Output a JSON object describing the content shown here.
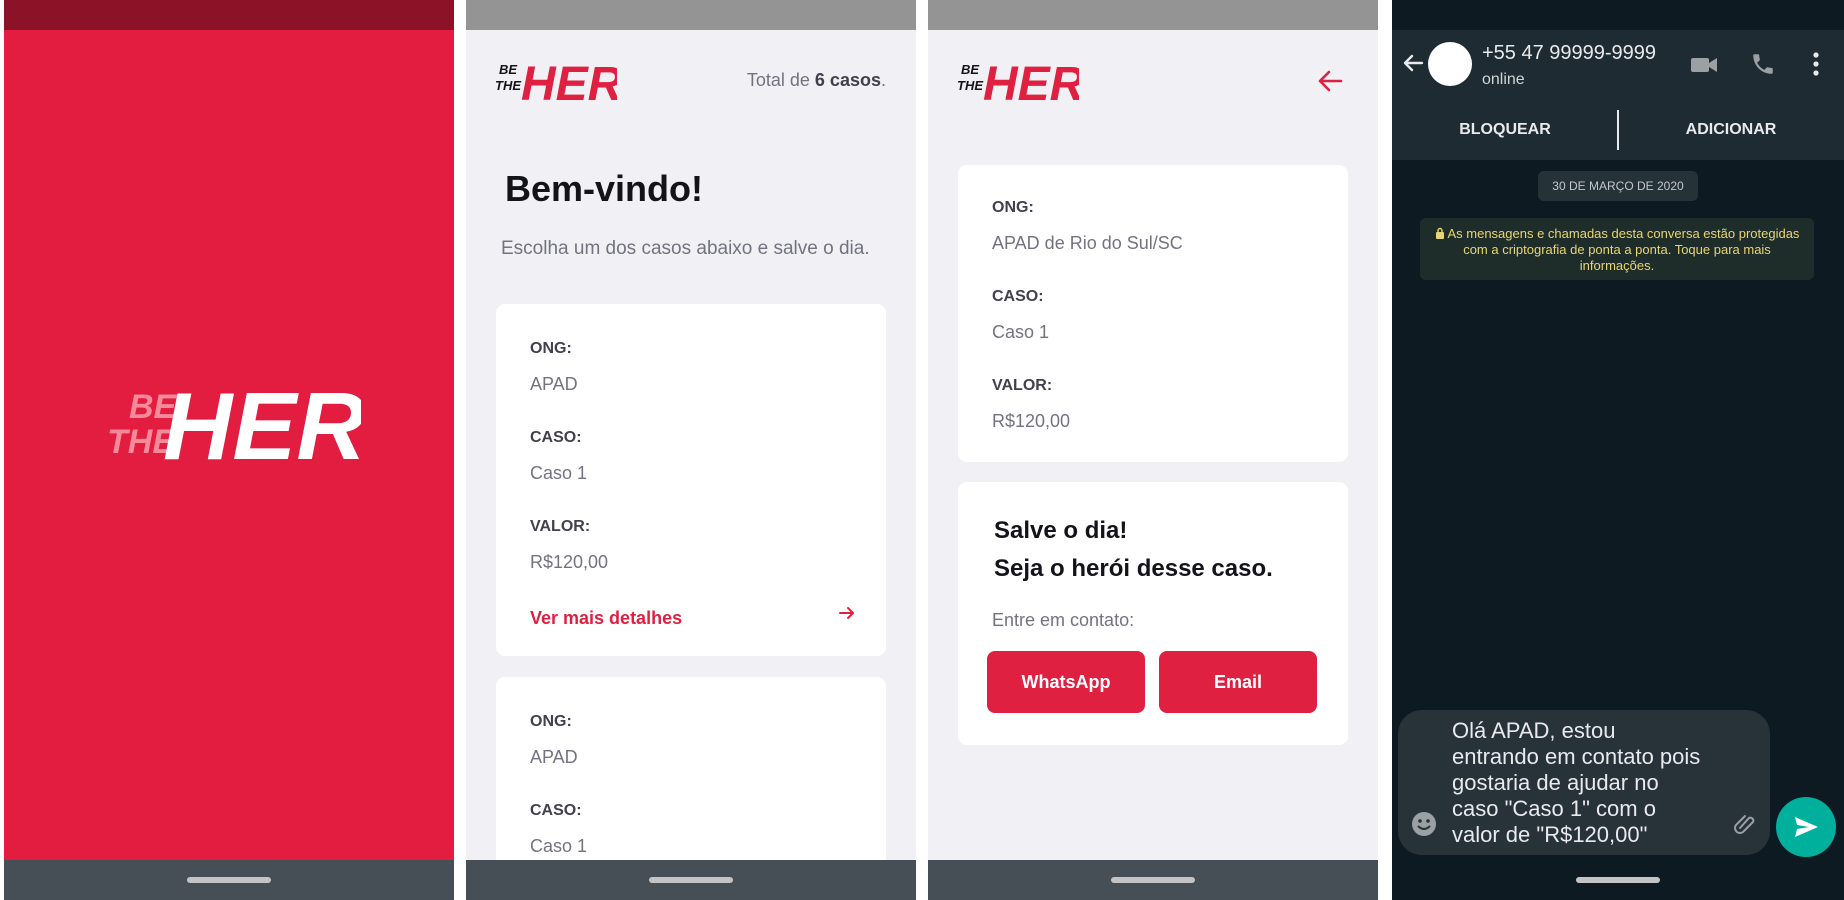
{
  "colors": {
    "brand_red": "#e02041",
    "splash_bg": "#e31d40",
    "app_bg": "#f0f0f5",
    "wa_bg": "#0e1a21",
    "wa_send": "#00af9c"
  },
  "logo": {
    "small": "BE THE",
    "big": "HERO"
  },
  "list_screen": {
    "total_prefix": "Total de ",
    "total_count": "6 casos",
    "total_suffix": ".",
    "title": "Bem-vindo!",
    "subtitle": "Escolha um dos casos abaixo e salve o dia.",
    "cards": [
      {
        "ong_label": "ONG:",
        "ong": "APAD",
        "caso_label": "CASO:",
        "caso": "Caso 1",
        "valor_label": "VALOR:",
        "valor": "R$120,00",
        "link": "Ver mais detalhes"
      },
      {
        "ong_label": "ONG:",
        "ong": "APAD",
        "caso_label": "CASO:",
        "caso": "Caso 1"
      }
    ]
  },
  "detail_screen": {
    "ong_label": "ONG:",
    "ong": "APAD de Rio do Sul/SC",
    "caso_label": "CASO:",
    "caso": "Caso 1",
    "valor_label": "VALOR:",
    "valor": "R$120,00",
    "hero_line1": "Salve o dia!",
    "hero_line2": "Seja o herói desse caso.",
    "contact_label": "Entre em contato:",
    "whatsapp_button": "WhatsApp",
    "email_button": "Email"
  },
  "whatsapp": {
    "phone": "+55  47 99999-9999",
    "status": "online",
    "block": "BLOQUEAR",
    "add": "ADICIONAR",
    "date": "30 DE MARÇO DE 2020",
    "encryption_notice": "As mensagens e chamadas desta conversa estão protegidas com a criptografia de ponta a ponta. Toque para mais informações.",
    "message": "Olá APAD, estou entrando em contato pois gostaria  de ajudar no caso \"Caso 1\" com o valor de \"R$120,00\""
  }
}
